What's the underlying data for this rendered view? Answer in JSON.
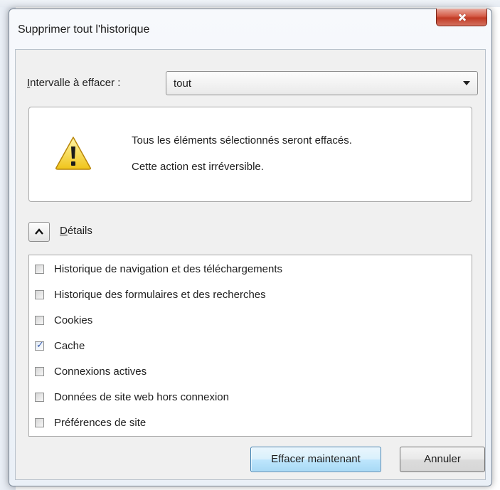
{
  "window": {
    "title": "Supprimer tout l'historique",
    "close_icon": "close-icon"
  },
  "range": {
    "label_accel": "I",
    "label_rest": "ntervalle à effacer :",
    "selected": "tout"
  },
  "warning": {
    "icon": "warning-icon",
    "line1": "Tous les éléments sélectionnés seront effacés.",
    "line2": "Cette action est irréversible."
  },
  "details": {
    "toggle_icon": "chevron-up-icon",
    "label_accel": "D",
    "label_rest": "étails"
  },
  "items": [
    {
      "label": "Historique de navigation et des téléchargements",
      "checked": false
    },
    {
      "label": "Historique des formulaires et des recherches",
      "checked": false
    },
    {
      "label": "Cookies",
      "checked": false
    },
    {
      "label": "Cache",
      "checked": true
    },
    {
      "label": "Connexions actives",
      "checked": false
    },
    {
      "label": "Données de site web hors connexion",
      "checked": false
    },
    {
      "label": "Préférences de site",
      "checked": false
    }
  ],
  "buttons": {
    "clear": "Effacer maintenant",
    "cancel": "Annuler"
  }
}
